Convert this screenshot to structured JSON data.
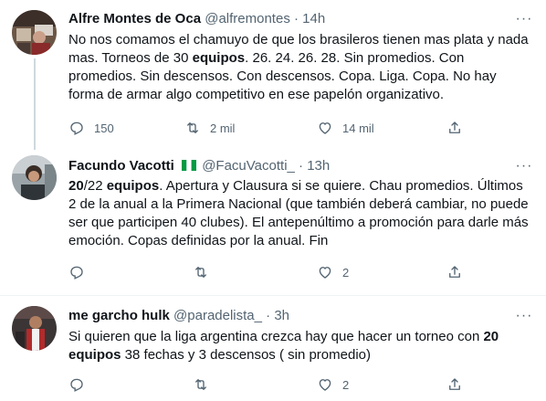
{
  "tweets": [
    {
      "name": "Alfre Montes de Oca",
      "handle": "@alfremontes",
      "sep": "·",
      "time": "14h",
      "text_parts": [
        {
          "t": "No nos comamos el chamuyo de que los brasileros tienen mas plata y nada mas. Torneos de 30 ",
          "b": false
        },
        {
          "t": "equipos",
          "b": true
        },
        {
          "t": ". 26. 24. 26. 28. Sin promedios. Con promedios. Sin descensos. Con descensos. Copa. Liga. Copa. No hay forma de armar algo competitivo en ese papelón organizativo.",
          "b": false
        }
      ],
      "replies": "150",
      "retweets": "2 mil",
      "likes": "14 mil"
    },
    {
      "name": "Facundo Vacotti",
      "handle": "@FacuVacotti_",
      "sep": "·",
      "time": "13h",
      "flag_colors": [
        "#009a44",
        "#ffffff",
        "#009a44"
      ],
      "text_parts": [
        {
          "t": "20",
          "b": true
        },
        {
          "t": "/22 ",
          "b": false
        },
        {
          "t": "equipos",
          "b": true
        },
        {
          "t": ". Apertura y Clausura si se quiere. Chau promedios. Últimos 2 de la anual a la Primera Nacional (que también deberá cambiar, no puede ser que participen 40 clubes). El antepenúltimo a promoción para darle más emoción. Copas definidas por la anual. Fin",
          "b": false
        }
      ],
      "replies": "",
      "retweets": "",
      "likes": "2"
    },
    {
      "name": "me garcho hulk",
      "handle": "@paradelista_",
      "sep": "·",
      "time": "3h",
      "text_parts": [
        {
          "t": "Si quieren que la liga argentina crezca hay que hacer un torneo con ",
          "b": false
        },
        {
          "t": "20 equipos",
          "b": true
        },
        {
          "t": " 38 fechas y 3 descensos  ( sin promedio)",
          "b": false
        }
      ],
      "replies": "",
      "retweets": "",
      "likes": "2"
    }
  ],
  "more_label": "···",
  "colors": {
    "text": "#0f1419",
    "secondary": "#536471",
    "thread_line": "#cfd9de",
    "divider": "#eff3f4"
  },
  "icons": [
    "reply-icon",
    "retweet-icon",
    "like-icon",
    "share-icon",
    "more-icon"
  ]
}
